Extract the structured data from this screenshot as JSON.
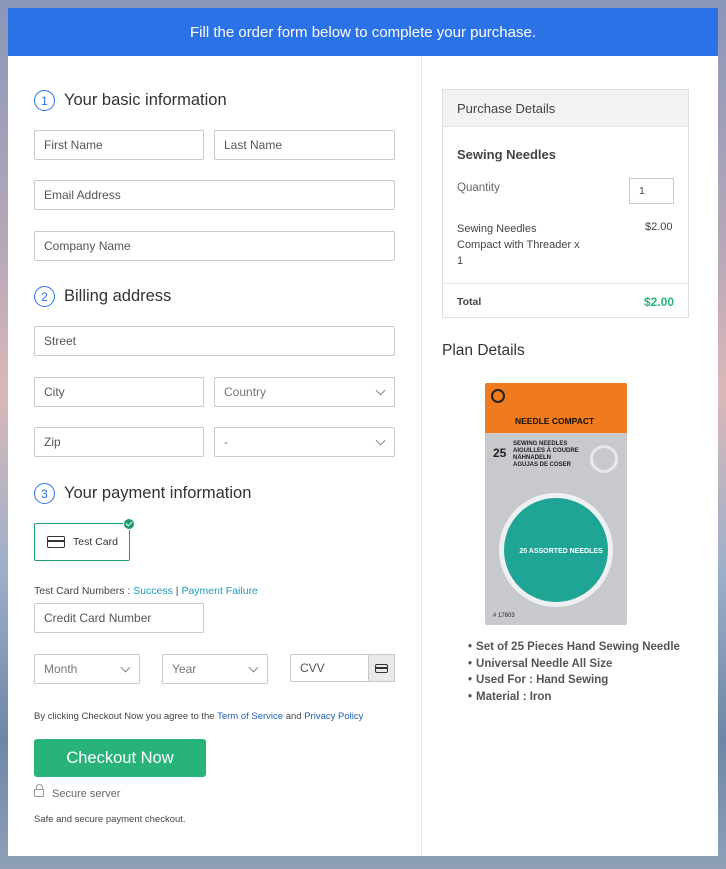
{
  "banner": {
    "text": "Fill the order form below to complete your purchase."
  },
  "basic_info": {
    "step": "1",
    "title": "Your basic information",
    "first_name_placeholder": "First Name",
    "last_name_placeholder": "Last Name",
    "email_placeholder": "Email Address",
    "company_placeholder": "Company Name"
  },
  "billing": {
    "step": "2",
    "title": "Billing address",
    "street_placeholder": "Street",
    "city_placeholder": "City",
    "country_value": "Country",
    "zip_placeholder": "Zip",
    "state_value": "-"
  },
  "payment": {
    "step": "3",
    "title": "Your payment information",
    "test_card_label": "Test Card",
    "test_numbers_label": "Test Card Numbers : ",
    "success_link": "Success",
    "separator": " | ",
    "failure_link": "Payment Failure",
    "card_number_placeholder": "Credit Card Number",
    "month_value": "Month",
    "year_value": "Year",
    "cvv_placeholder": "CVV",
    "agree_prefix": "By clicking Checkout Now you agree to the ",
    "terms_link": "Term of Service",
    "and_text": " and ",
    "privacy_link": "Privacy Policy",
    "checkout_button": "Checkout Now",
    "secure_label": "Secure server",
    "safe_label": "Safe and secure payment checkout."
  },
  "purchase": {
    "header": "Purchase Details",
    "product_name": "Sewing Needles",
    "quantity_label": "Quantity",
    "quantity_value": "1",
    "item_line1": "Sewing Needles",
    "item_line2": "Compact with Threader x",
    "item_line3": "1",
    "item_price": "$2.00",
    "total_label": "Total",
    "total_value": "$2.00",
    "total_color": "#27b37a"
  },
  "plan": {
    "title": "Plan Details",
    "product_image": {
      "brand": "NEEDLE COMPACT",
      "count": "25",
      "line1": "SEWING NEEDLES",
      "line2": "AIGUILLES À COUDRE",
      "line3": "NÄHNADELN",
      "line4": "AGUJAS DE COSER",
      "circle_label": "25 ASSORTED NEEDLES",
      "code": "# 17603"
    },
    "features": [
      "Set of 25 Pieces Hand Sewing Needle",
      "Universal Needle All Size",
      "Used For : Hand Sewing",
      "Material : Iron"
    ]
  },
  "colors": {
    "accent": "#2b72e6",
    "checkout": "#27b37a",
    "link": "#1a9bc1"
  }
}
